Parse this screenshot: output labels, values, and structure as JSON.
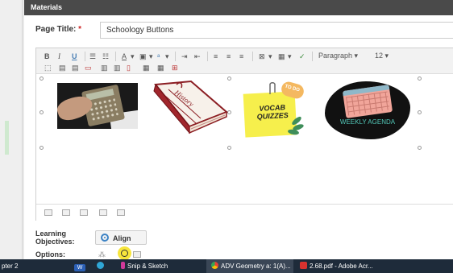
{
  "modal": {
    "header": "Materials"
  },
  "form": {
    "page_title_label": "Page Title:",
    "required_mark": "*",
    "page_title_value": "Schoology Buttons"
  },
  "toolbar": {
    "bold": "B",
    "italic": "I",
    "underline": "U",
    "font_color": "A",
    "paragraph": "Paragraph",
    "font_size": "12",
    "dropdown_arrow": "▾"
  },
  "images": {
    "history_text": "History",
    "vocab_text": "VOCAB QUIZZES",
    "todo_text": "TO DO",
    "agenda_text": "WEEKLY AGENDA"
  },
  "learning": {
    "label_line1": "Learning",
    "label_line2": "Objectives:",
    "align_button": "Align"
  },
  "options": {
    "label": "Options:"
  },
  "taskbar": {
    "items": [
      {
        "label": "pter 2"
      },
      {
        "label": "W"
      },
      {
        "label": "Snip & Sketch"
      },
      {
        "label": "ADV Geometry a: 1(A)..."
      },
      {
        "label": "2.68.pdf - Adobe Acr..."
      }
    ]
  },
  "colors": {
    "header_bg": "#4a4a4a",
    "required": "#cc2222",
    "align_icon": "#3c82c4",
    "highlight": "#f7e53b",
    "taskbar_bg": "#1e2b3a"
  },
  "icons": [
    "bold-icon",
    "italic-icon",
    "underline-icon",
    "bullet-list-icon",
    "numbered-list-icon",
    "font-color-icon",
    "highlight-icon",
    "superscript-icon",
    "indent-icon",
    "outdent-icon",
    "align-left-icon",
    "align-center-icon",
    "align-right-icon",
    "insert-math-icon",
    "table-icon",
    "spellcheck-icon",
    "undo-icon",
    "redo-icon"
  ]
}
